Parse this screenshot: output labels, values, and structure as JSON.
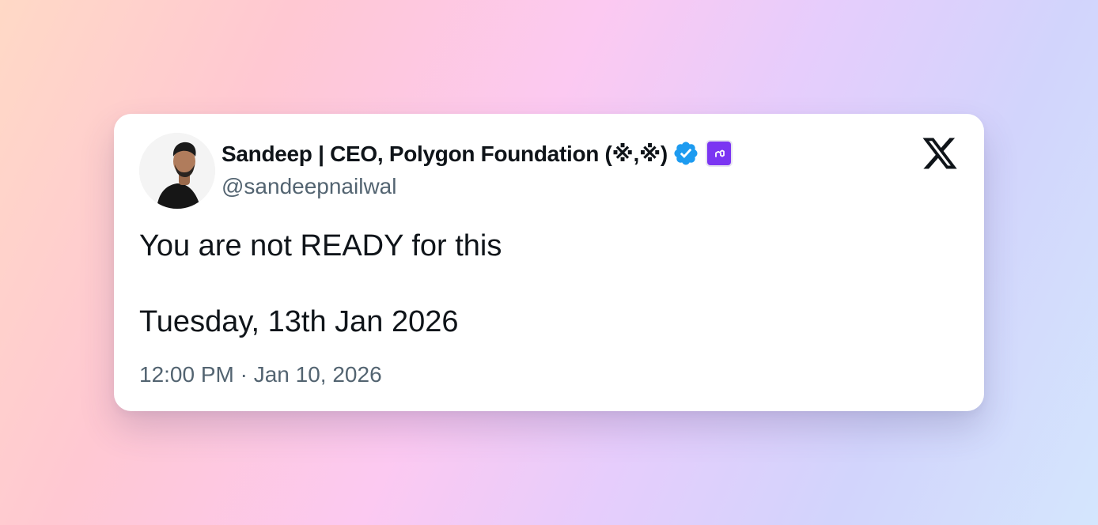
{
  "tweet": {
    "author": {
      "display_name": "Sandeep | CEO, Polygon Foundation (※,※)",
      "handle": "@sandeepnailwal",
      "avatar_icon": "profile-photo",
      "verified_icon": "verified-badge-icon",
      "affiliate_icon": "polygon-affiliate-badge-icon"
    },
    "platform_icon": "x-logo-icon",
    "text_line_1": "You are not READY for this",
    "text_line_2": "Tuesday, 13th Jan 2026",
    "timestamp": "12:00 PM · Jan 10, 2026"
  },
  "colors": {
    "verified": "#1d9bf0",
    "affiliate": "#7b35f2",
    "text_primary": "#0f1419",
    "text_secondary": "#536471"
  }
}
